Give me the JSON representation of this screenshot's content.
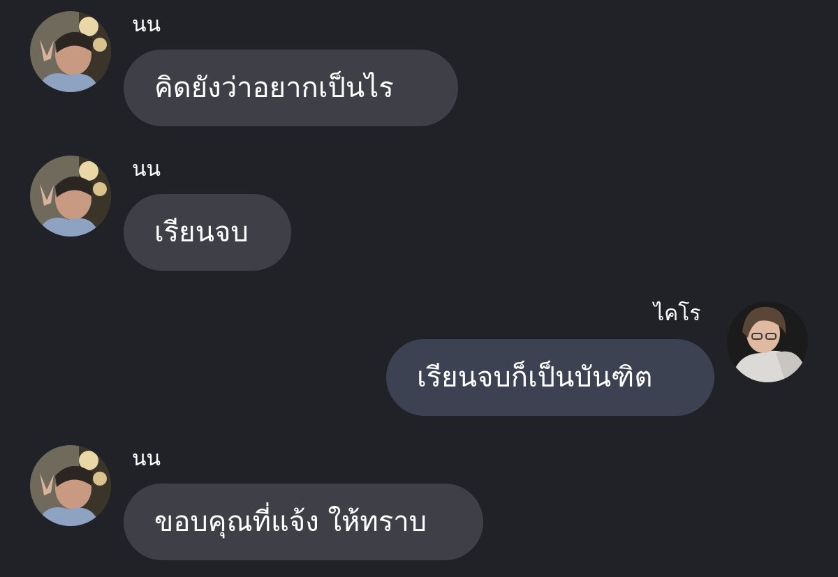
{
  "colors": {
    "background": "#212227",
    "incoming_bubble": "#3f4047",
    "outgoing_bubble": "#3c4252",
    "text": "#ffffff"
  },
  "messages": [
    {
      "sender": "นน",
      "text": "คิดยังว่าอยากเป็นไร",
      "direction": "incoming",
      "avatar": "user-avatar-non"
    },
    {
      "sender": "นน",
      "text": "เรียนจบ",
      "direction": "incoming",
      "avatar": "user-avatar-non"
    },
    {
      "sender": "ไคโร",
      "text": "เรียนจบก็เป็นบันฑิต",
      "direction": "outgoing",
      "avatar": "user-avatar-kairo"
    },
    {
      "sender": "นน",
      "text": "ขอบคุณที่แจ้ง ให้ทราบ",
      "direction": "incoming",
      "avatar": "user-avatar-non"
    }
  ]
}
